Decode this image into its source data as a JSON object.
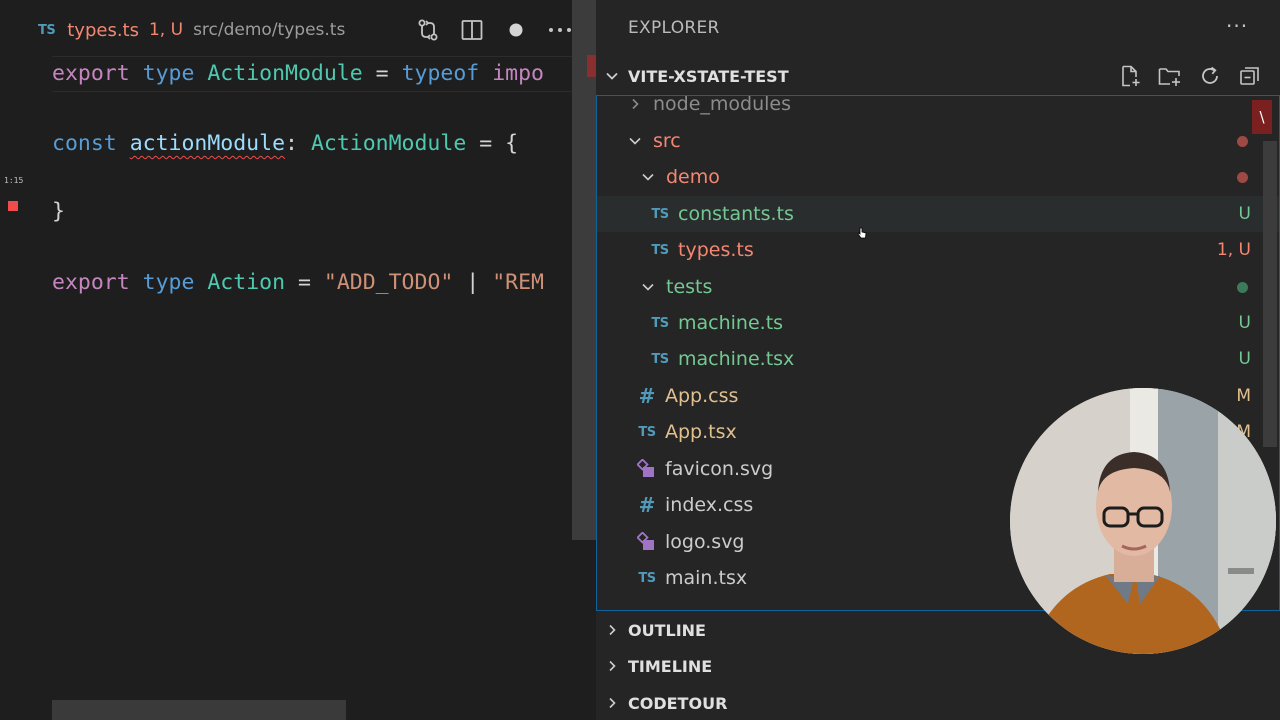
{
  "editor": {
    "tab": {
      "icon": "TS",
      "filename": "types.ts",
      "status": "1, U",
      "path": "src/demo/types.ts"
    },
    "gutter_label": "1:15",
    "lines": {
      "l1": {
        "a": "export",
        "b": "type",
        "c": "ActionModule",
        "d": "=",
        "e": "typeof",
        "f": "impo"
      },
      "l2": {
        "a": "const",
        "b": "actionModule",
        "c": ":",
        "d": "ActionModule",
        "e": "=",
        "f": "{"
      },
      "l3": {
        "a": "}"
      },
      "l4": {
        "a": "export",
        "b": "type",
        "c": "Action",
        "d": "=",
        "e": "\"ADD_TODO\"",
        "f": "|",
        "g": "\"REM"
      }
    }
  },
  "sidebar": {
    "title": "EXPLORER",
    "more": "···",
    "project": "VITE-XSTATE-TEST",
    "error_badge": "\\",
    "tree": [
      {
        "label": "node_modules",
        "kind": "folder",
        "expanded": false
      },
      {
        "label": "src",
        "kind": "folder",
        "expanded": true
      },
      {
        "label": "demo",
        "kind": "folder",
        "expanded": true
      },
      {
        "label": "constants.ts",
        "icon": "TS",
        "status": "U"
      },
      {
        "label": "types.ts",
        "icon": "TS",
        "status": "1, U"
      },
      {
        "label": "tests",
        "kind": "folder",
        "expanded": true
      },
      {
        "label": "machine.ts",
        "icon": "TS",
        "status": "U"
      },
      {
        "label": "machine.tsx",
        "icon": "TS",
        "status": "U"
      },
      {
        "label": "App.css",
        "icon": "#",
        "status": "M"
      },
      {
        "label": "App.tsx",
        "icon": "TS",
        "status": "M"
      },
      {
        "label": "favicon.svg",
        "icon": "svg"
      },
      {
        "label": "index.css",
        "icon": "#"
      },
      {
        "label": "logo.svg",
        "icon": "svg"
      },
      {
        "label": "main.tsx",
        "icon": "TS"
      }
    ],
    "sections": {
      "outline": "OUTLINE",
      "timeline": "TIMELINE",
      "codetour": "CODETOUR"
    }
  },
  "colors": {
    "untracked": "#73c991",
    "modified": "#e2c08d",
    "error": "#f48771",
    "ts_icon": "#519aba",
    "focus_border": "#0e639c"
  }
}
